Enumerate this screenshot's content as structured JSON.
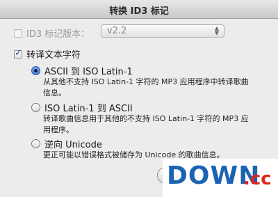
{
  "window": {
    "title": "转换 ID3 标记"
  },
  "id3_version": {
    "checkbox_label": "ID3 标记版本：",
    "checked": false,
    "enabled": false,
    "selected_value": "v2.2"
  },
  "convert_text": {
    "checkbox_label": "转译文本字符",
    "checked": true
  },
  "options": [
    {
      "label": "ASCII 到 ISO Latin-1",
      "selected": true,
      "desc_line1": "从其他不支持 ISO Latin-1 字符的 MP3 应用程序中转译歌曲",
      "desc_line2": "信息。"
    },
    {
      "label": "ISO Latin-1 到 ASCII",
      "selected": false,
      "desc_line1": "转译歌曲信息用于其他的不支持 ISO Latin-1 字符的 MP3 应",
      "desc_line2": "用程序。"
    },
    {
      "label": "逆向 Unicode",
      "selected": false,
      "desc_line1": "更正可能以错误格式被储存为 Unicode 的歌曲信息。"
    }
  ],
  "watermark": {
    "logo_main": "DOWN",
    "logo_suffix": ".cc"
  }
}
